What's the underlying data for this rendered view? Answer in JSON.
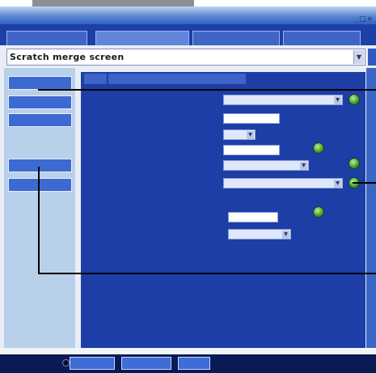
{
  "window": {
    "controls": "_□×"
  },
  "tabs": [
    {
      "label": "",
      "active": false
    },
    {
      "label": "",
      "active": true
    },
    {
      "label": "",
      "active": false
    },
    {
      "label": "",
      "active": false
    }
  ],
  "title_field": {
    "value": "Scratch merge screen",
    "dropdown_icon": "chevron-down-icon"
  },
  "sidebar": {
    "items": [
      {
        "label": ""
      },
      {
        "label": ""
      },
      {
        "label": ""
      },
      {
        "label": ""
      },
      {
        "label": ""
      }
    ]
  },
  "main": {
    "tabs": [
      {
        "label": ""
      },
      {
        "label": ""
      }
    ],
    "rows": [
      {
        "label": "",
        "value": "",
        "kind": "select",
        "unit": "",
        "has_button": true
      },
      {
        "label": "",
        "value": "",
        "kind": "text",
        "unit": "",
        "has_button": false
      },
      {
        "label": "",
        "value": "",
        "kind": "select",
        "unit": "",
        "has_button": false
      },
      {
        "label": "",
        "value": "",
        "kind": "text",
        "unit": "",
        "has_button": false
      },
      {
        "label": "",
        "value": "",
        "kind": "select",
        "unit": "",
        "has_button": true
      },
      {
        "label": "",
        "value": "",
        "kind": "select",
        "unit": "",
        "has_button": true
      },
      {
        "label": "",
        "value": "",
        "kind": "none",
        "unit": "",
        "has_button": false
      },
      {
        "label": "",
        "value": "",
        "kind": "text",
        "unit": "",
        "has_button": true
      },
      {
        "label": "",
        "value": "",
        "kind": "select",
        "unit": "",
        "has_button": false
      }
    ]
  },
  "bottom_buttons": [
    {
      "label": ""
    },
    {
      "label": ""
    },
    {
      "label": ""
    }
  ],
  "colors": {
    "accent_blue": "#1c3ea6",
    "tab_bar": "#1c3fa8",
    "sidebar_bg": "#b9d0ea",
    "go_button": "#3f9b2f",
    "callout_line": "#000000"
  }
}
